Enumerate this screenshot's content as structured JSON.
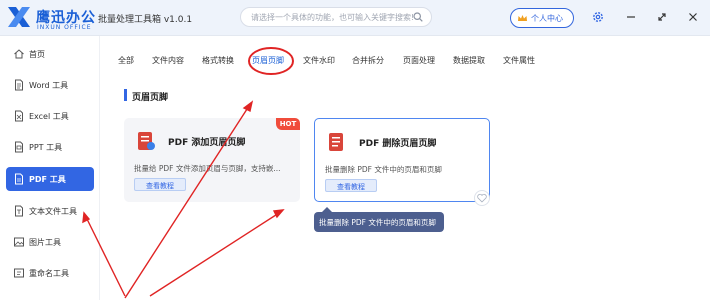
{
  "titlebar": {
    "logo_cn": "鹰迅办公",
    "logo_en": "INXUN OFFICE",
    "app_title": "批量处理工具箱 v1.0.1",
    "search_placeholder": "请选择一个具体的功能，也可输入关键字搜索!",
    "user_center": "个人中心"
  },
  "sidebar": {
    "items": [
      {
        "label": "首页",
        "icon": "home-icon"
      },
      {
        "label": "Word 工具",
        "icon": "word-doc-icon"
      },
      {
        "label": "Excel 工具",
        "icon": "excel-doc-icon"
      },
      {
        "label": "PPT 工具",
        "icon": "ppt-doc-icon"
      },
      {
        "label": "PDF 工具",
        "icon": "pdf-doc-icon",
        "active": true
      },
      {
        "label": "文本文件工具",
        "icon": "text-file-icon"
      },
      {
        "label": "图片工具",
        "icon": "image-icon"
      },
      {
        "label": "重命名工具",
        "icon": "rename-icon"
      }
    ]
  },
  "tabs": [
    "全部",
    "文件内容",
    "格式转换",
    "页眉页脚",
    "文件水印",
    "合并拆分",
    "页面处理",
    "数据提取",
    "文件属性"
  ],
  "active_tab": "页眉页脚",
  "section_title": "页眉页脚",
  "cards": [
    {
      "title": "PDF 添加页眉页脚",
      "desc": "批量给 PDF 文件添加页眉与页脚，支持嵌...",
      "button": "查看教程",
      "badge": "HOT"
    },
    {
      "title": "PDF 删除页眉页脚",
      "desc": "批量删除 PDF 文件中的页眉和页脚",
      "button": "查看教程"
    }
  ],
  "tooltip": "批量删除 PDF 文件中的页眉和页脚",
  "colors": {
    "accent": "#3266e3",
    "annotation": "#e02424",
    "hot": "#f04c3b"
  }
}
